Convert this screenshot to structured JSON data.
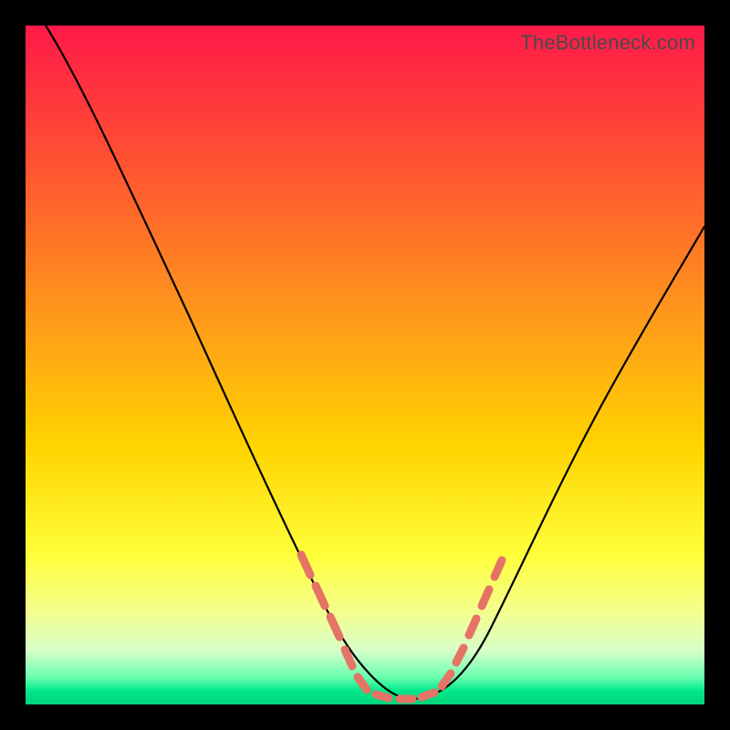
{
  "watermark": "TheBottleneck.com",
  "colors": {
    "page_bg": "#000000",
    "gradient_top": "#ff1a4a",
    "gradient_bottom": "#00d47a",
    "curve": "#000000",
    "marker": "#e57366"
  },
  "chart_data": {
    "type": "line",
    "title": "",
    "xlabel": "",
    "ylabel": "",
    "xlim": [
      0,
      100
    ],
    "ylim": [
      0,
      100
    ],
    "grid": false,
    "legend": false,
    "description": "V-shaped bottleneck curve with minimum near x≈55; left branch steeper than right",
    "series": [
      {
        "name": "bottleneck-curve",
        "x": [
          3,
          10,
          18,
          26,
          34,
          40,
          44,
          48,
          52,
          56,
          60,
          64,
          68,
          72,
          80,
          88,
          96,
          100
        ],
        "y": [
          100,
          88,
          73,
          56,
          38,
          24,
          14,
          6,
          2,
          1,
          2,
          6,
          13,
          22,
          38,
          53,
          67,
          74
        ]
      }
    ],
    "markers": {
      "name": "highlighted-segment",
      "note": "coral dashed/dotted overlay near the valley",
      "x": [
        40,
        42,
        44,
        47,
        49,
        51,
        53,
        55,
        57,
        59,
        61,
        63,
        65,
        67,
        69
      ],
      "y": [
        24,
        19,
        14,
        8,
        4,
        2,
        1,
        1,
        1,
        2,
        4,
        7,
        11,
        16,
        20
      ]
    }
  }
}
